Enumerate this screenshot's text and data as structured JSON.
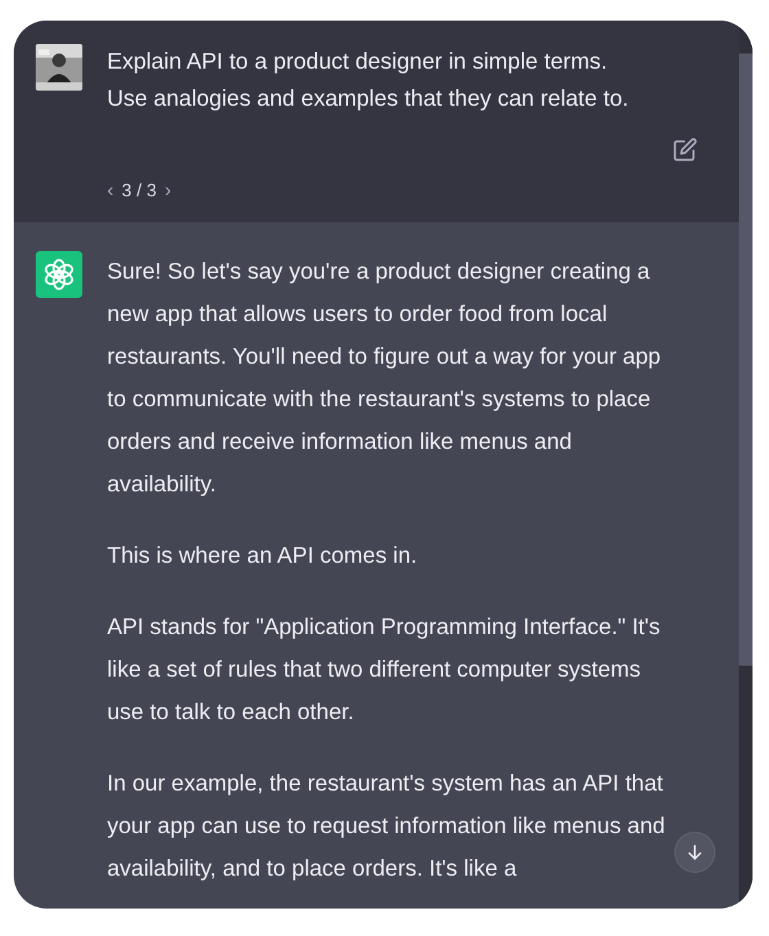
{
  "user_message": {
    "text": "Explain API to a product designer in simple terms. Use analogies and examples that they can relate to.",
    "pager": {
      "prev": "‹",
      "label": "3 / 3",
      "next": "›"
    }
  },
  "assistant_message": {
    "paragraphs": [
      "Sure! So let's say you're a product designer creating a new app that allows users to order food from local restaurants. You'll need to figure out a way for your app to communicate with the restaurant's systems to place orders and receive information like menus and availability.",
      "This is where an API comes in.",
      "API stands for \"Application Programming Interface.\" It's like a set of rules that two different computer systems use to talk to each other.",
      "In our example, the restaurant's system has an API that your app can use to request information like menus and availability, and to place orders. It's like a"
    ]
  }
}
